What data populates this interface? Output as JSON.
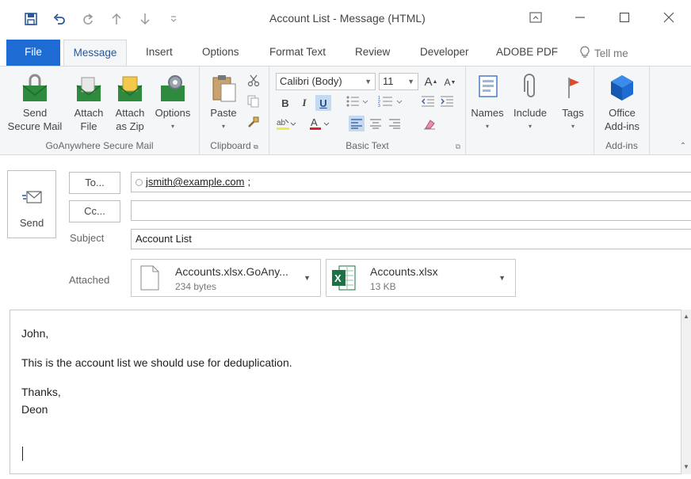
{
  "window": {
    "title": "Account List  -  Message (HTML)"
  },
  "quick_access": [
    {
      "icon": "save-icon"
    },
    {
      "icon": "undo-icon"
    },
    {
      "icon": "redo-icon"
    },
    {
      "icon": "up-arrow-icon"
    },
    {
      "icon": "down-arrow-icon"
    },
    {
      "icon": "customize-qat-icon"
    }
  ],
  "tabs": {
    "file": "File",
    "message": "Message",
    "insert": "Insert",
    "options": "Options",
    "format_text": "Format Text",
    "review": "Review",
    "developer": "Developer",
    "adobe_pdf": "ADOBE PDF",
    "tell_me": "Tell me"
  },
  "ribbon": {
    "goanywhere": {
      "label": "GoAnywhere Secure Mail",
      "send_secure_1": "Send",
      "send_secure_2": "Secure Mail",
      "attach_file_1": "Attach",
      "attach_file_2": "File",
      "attach_zip_1": "Attach",
      "attach_zip_2": "as Zip",
      "options": "Options"
    },
    "clipboard": {
      "label": "Clipboard",
      "paste": "Paste"
    },
    "basic_text": {
      "label": "Basic Text",
      "font": "Calibri (Body)",
      "size": "11",
      "bold": "B",
      "italic": "I",
      "underline": "U",
      "grow": "A",
      "shrink": "A"
    },
    "names": "Names",
    "include": "Include",
    "tags": "Tags",
    "addins": {
      "label": "Add-ins",
      "office_1": "Office",
      "office_2": "Add-ins"
    }
  },
  "message": {
    "send": "Send",
    "to_button": "To...",
    "cc_button": "Cc...",
    "subject_label": "Subject",
    "attached_label": "Attached",
    "to_value": "jsmith@example.com",
    "to_suffix": ";",
    "cc_value": "",
    "subject_value": "Account List",
    "attachments": [
      {
        "name": "Accounts.xlsx.GoAny...",
        "size": "234 bytes",
        "icon": "file-icon"
      },
      {
        "name": "Accounts.xlsx",
        "size": "13 KB",
        "icon": "excel-icon"
      }
    ]
  },
  "body": {
    "lines": [
      "John,",
      "This is the account list we should use for deduplication.",
      "Thanks,",
      "Deon"
    ]
  },
  "colors": {
    "accent": "#2b579a",
    "file_tab": "#1e6cd3",
    "ribbon_bg": "#f5f6f7"
  }
}
